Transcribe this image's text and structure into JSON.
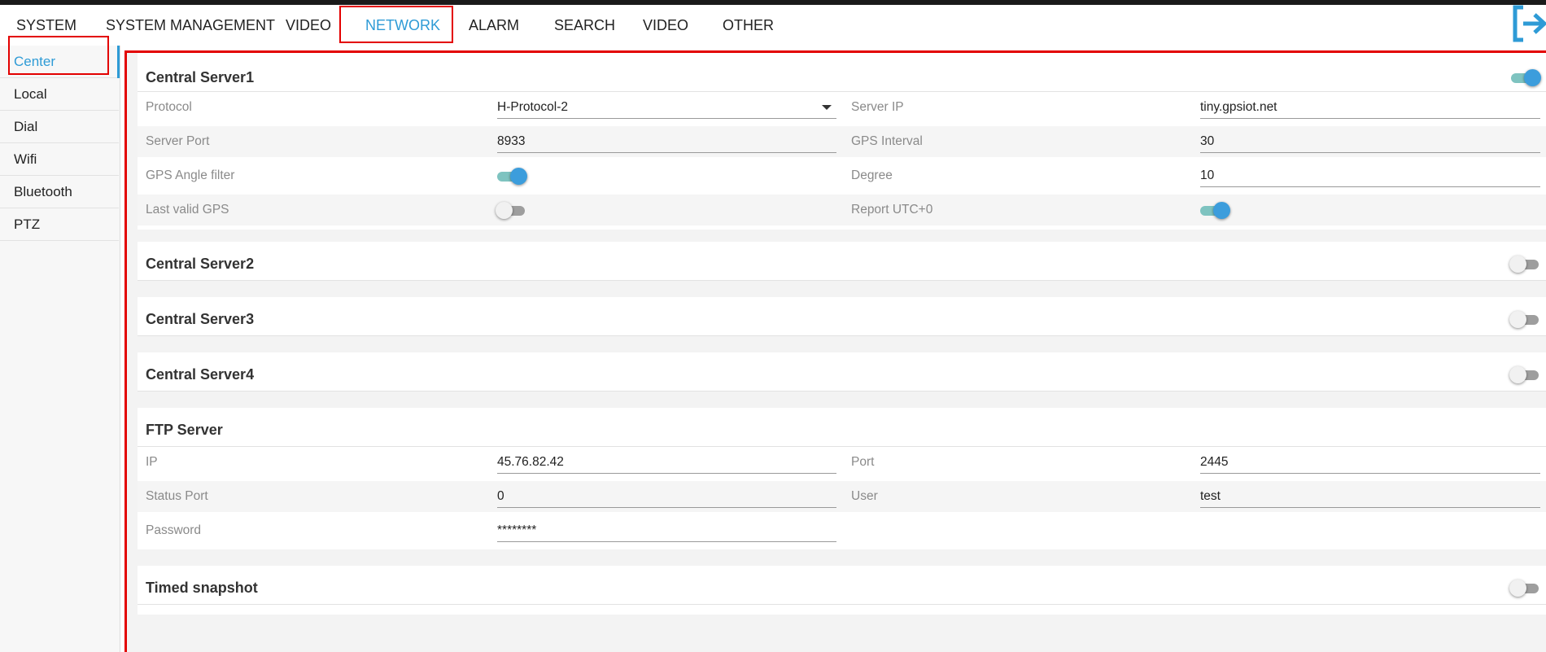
{
  "top_nav": {
    "tabs": [
      {
        "label": "SYSTEM"
      },
      {
        "label": "SYSTEM MANAGEMENT"
      },
      {
        "label": "VIDEO"
      },
      {
        "label": "NETWORK",
        "active": true
      },
      {
        "label": "ALARM"
      },
      {
        "label": "SEARCH"
      },
      {
        "label": "VIDEO"
      },
      {
        "label": "OTHER"
      }
    ],
    "logout_icon": "logout-arrow-icon"
  },
  "sidebar": {
    "items": [
      {
        "label": "Center",
        "active": true
      },
      {
        "label": "Local"
      },
      {
        "label": "Dial"
      },
      {
        "label": "Wifi"
      },
      {
        "label": "Bluetooth"
      },
      {
        "label": "PTZ"
      }
    ]
  },
  "server1": {
    "title": "Central Server1",
    "enabled": true,
    "protocol": {
      "label": "Protocol",
      "value": "H-Protocol-2"
    },
    "server_ip": {
      "label": "Server IP",
      "value": "tiny.gpsiot.net"
    },
    "server_port": {
      "label": "Server Port",
      "value": "8933"
    },
    "gps_interval": {
      "label": "GPS Interval",
      "value": "30"
    },
    "gps_angle_filter": {
      "label": "GPS Angle filter",
      "enabled": true
    },
    "degree": {
      "label": "Degree",
      "value": "10"
    },
    "last_valid_gps": {
      "label": "Last valid GPS",
      "enabled": false
    },
    "report_utc": {
      "label": "Report UTC+0",
      "enabled": true
    }
  },
  "server2": {
    "title": "Central Server2",
    "enabled": false
  },
  "server3": {
    "title": "Central Server3",
    "enabled": false
  },
  "server4": {
    "title": "Central Server4",
    "enabled": false
  },
  "ftp": {
    "title": "FTP Server",
    "ip": {
      "label": "IP",
      "value": "45.76.82.42"
    },
    "port": {
      "label": "Port",
      "value": "2445"
    },
    "status_port": {
      "label": "Status Port",
      "value": "0"
    },
    "user": {
      "label": "User",
      "value": "test"
    },
    "password": {
      "label": "Password",
      "value": "********"
    }
  },
  "timed_snapshot": {
    "title": "Timed snapshot",
    "enabled": false
  },
  "colors": {
    "accent": "#2e9bd6",
    "highlight_box": "#e30000",
    "toggle_on_knob": "#3c9ddc",
    "toggle_on_track": "#7ec3c0"
  }
}
